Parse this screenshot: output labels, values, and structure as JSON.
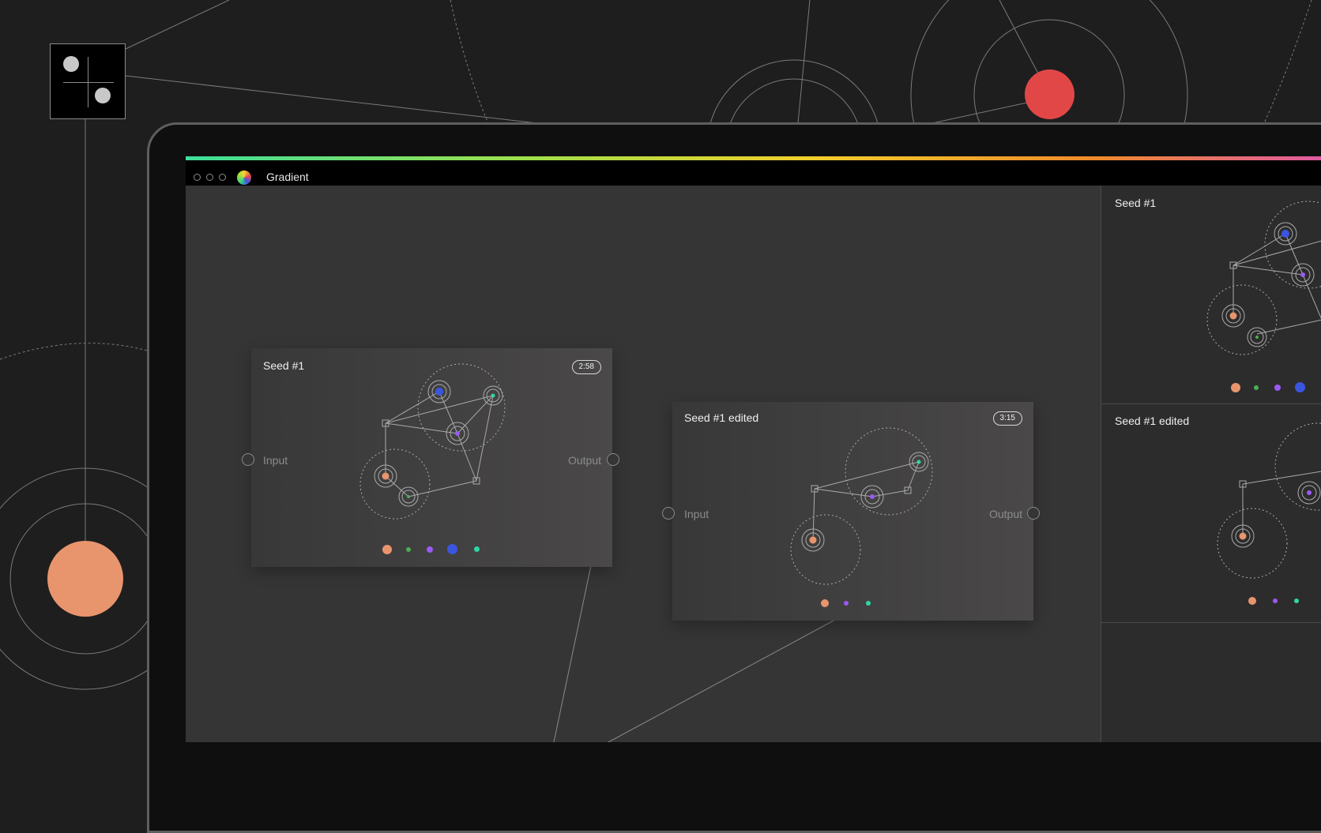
{
  "app": {
    "title": "Gradient",
    "icon": "color-wheel-icon"
  },
  "window_controls": [
    "close",
    "minimize",
    "maximize"
  ],
  "colors": {
    "orange": "#e8956e",
    "red": "#e24747",
    "green": "#4caf50",
    "purple": "#9b59f5",
    "blue": "#3a56e0",
    "teal": "#2fd6a6"
  },
  "cards": [
    {
      "title": "Seed #1",
      "duration": "2:58",
      "input_label": "Input",
      "output_label": "Output",
      "palette": [
        "orange",
        "green",
        "purple",
        "blue",
        "teal"
      ]
    },
    {
      "title": "Seed #1 edited",
      "duration": "3:15",
      "input_label": "Input",
      "output_label": "Output",
      "palette": [
        "orange",
        "purple",
        "teal"
      ]
    }
  ],
  "sidebar": {
    "panels": [
      {
        "title": "Seed #1",
        "palette": [
          "orange",
          "green",
          "purple",
          "blue"
        ]
      },
      {
        "title": "Seed #1 edited",
        "palette": [
          "orange",
          "purple",
          "teal"
        ]
      }
    ]
  }
}
